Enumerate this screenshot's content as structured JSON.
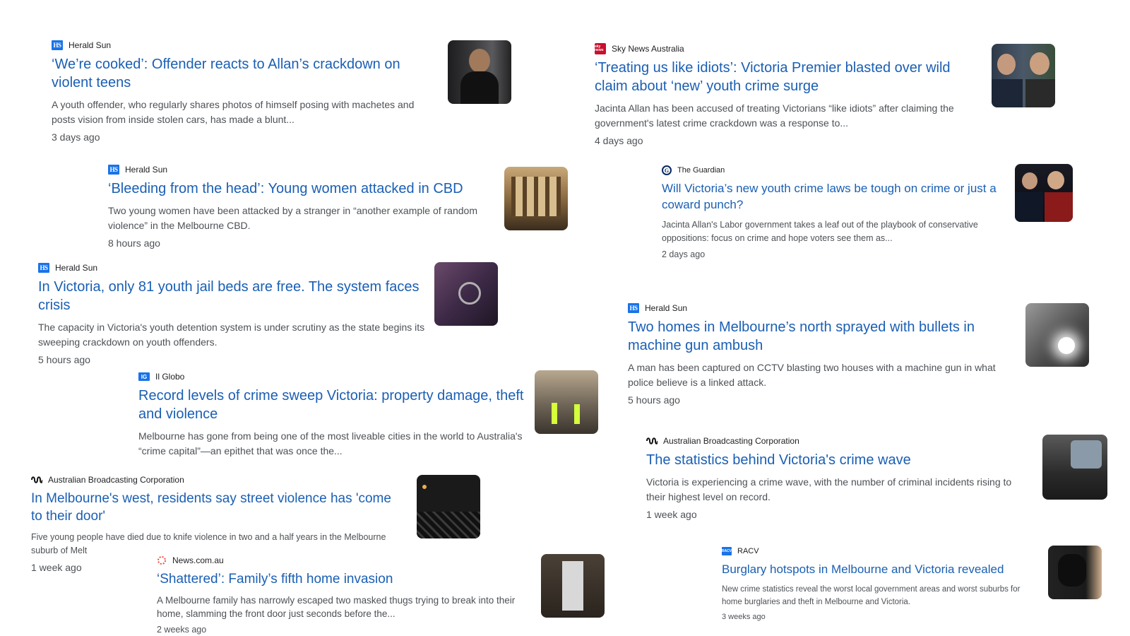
{
  "articles": [
    {
      "source": "Herald Sun",
      "title": "‘We’re cooked’: Offender reacts to Allan’s crackdown on violent teens",
      "snippet": "A youth offender, who regularly shares photos of himself posing with machetes and posts vision from inside stolen cars, has made a blunt...",
      "time": "3 days ago"
    },
    {
      "source": "Herald Sun",
      "title": "‘Bleeding from the head’: Young women attacked in CBD",
      "snippet": "Two young women have been attacked by a stranger in “another example of random violence” in the Melbourne CBD.",
      "time": "8 hours ago"
    },
    {
      "source": "Herald Sun",
      "title": "In Victoria, only 81 youth jail beds are free. The system faces crisis",
      "snippet": "The capacity in Victoria's youth detention system is under scrutiny as the state begins its sweeping crackdown on youth offenders.",
      "time": "5 hours ago"
    },
    {
      "source": "Il Globo",
      "title": "Record levels of crime sweep Victoria: property damage, theft and violence",
      "snippet": "Melbourne has gone from being one of the most liveable cities in the world to Australia's “crime capital”—an epithet that was once the...",
      "time": ""
    },
    {
      "source": "Australian Broadcasting Corporation",
      "title": "In Melbourne's west, residents say street violence has 'come to their door'",
      "snippet": "Five young people have died due to knife violence in two and a half years in the Melbourne suburb of Melt",
      "time": "1 week ago"
    },
    {
      "source": "News.com.au",
      "title": "‘Shattered’: Family’s fifth home invasion",
      "snippet": "A Melbourne family has narrowly escaped two masked thugs trying to break into their home, slamming the front door just seconds before the...",
      "time": "2 weeks ago"
    },
    {
      "source": "Sky News Australia",
      "title": "‘Treating us like idiots’: Victoria Premier blasted over wild claim about ‘new’ youth crime surge",
      "snippet": "Jacinta Allan has been accused of treating Victorians “like idiots” after claiming the government's latest crime crackdown was a response to...",
      "time": "4 days ago"
    },
    {
      "source": "The Guardian",
      "title": "Will Victoria’s new youth crime laws be tough on crime or just a coward punch?",
      "snippet": "Jacinta Allan's Labor government takes a leaf out of the playbook of conservative oppositions: focus on crime and hope voters see them as...",
      "time": "2 days ago"
    },
    {
      "source": "Herald Sun",
      "title": "Two homes in Melbourne’s north sprayed with bullets in machine gun ambush",
      "snippet": "A man has been captured on CCTV blasting two houses with a machine gun in what police believe is a linked attack.",
      "time": "5 hours ago"
    },
    {
      "source": "Australian Broadcasting Corporation",
      "title": "The statistics behind Victoria's crime wave",
      "snippet": "Victoria is experiencing a crime wave, with the number of criminal incidents rising to their highest level on record.",
      "time": "1 week ago"
    },
    {
      "source": "RACV",
      "title": "Burglary hotspots in Melbourne and Victoria revealed",
      "snippet": "New crime statistics reveal the worst local government areas and worst suburbs for home burglaries and theft in Melbourne and Victoria.",
      "time": "3 weeks ago"
    }
  ],
  "logo_text": {
    "hs": "HS",
    "sky": "sky news",
    "ig": "IG",
    "racv": "RACV"
  },
  "colors": {
    "link": "#1a5fb4",
    "snippet": "#4d5156",
    "source": "#202124",
    "hs_blue": "#1a73e8",
    "sky_red": "#c8102e"
  }
}
